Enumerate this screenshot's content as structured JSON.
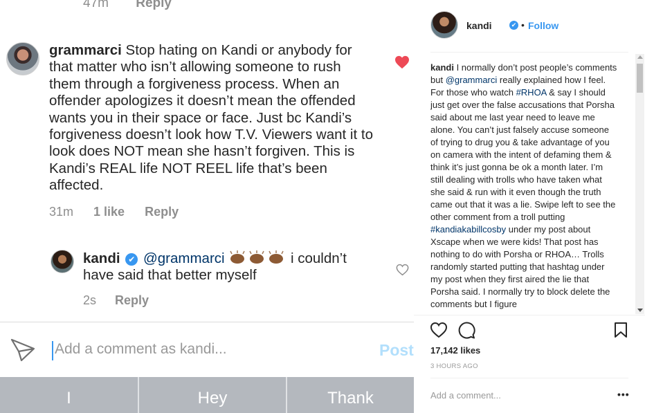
{
  "photo": {
    "top_meta": {
      "time": "47m",
      "reply": "Reply"
    },
    "comment": {
      "user": "grammarci",
      "text": "Stop hating on Kandi or anybody for that matter who isn’t allowing someone to rush them through a forgiveness process. When an offender apologizes it doesn’t mean the offended wants you in their space or face. Just bc Kandi’s forgiveness doesn’t look how T.V. Viewers want it to look does NOT mean she hasn’t forgiven. This is Kandi’s REAL life NOT REEL life that’s been affected.",
      "time": "31m",
      "likes": "1 like",
      "reply": "Reply",
      "liked": true
    },
    "reply_comment": {
      "user": "kandi",
      "verified_glyph": "✔",
      "mention": "@grammarci",
      "text": "i couldn’t have said that better myself",
      "time": "2s",
      "reply": "Reply"
    },
    "compose": {
      "placeholder": "Add a comment as kandi...",
      "post_label": "Post"
    },
    "keyboard_suggestions": [
      "I",
      "Hey",
      "Thank"
    ]
  },
  "panel": {
    "username": "kandi",
    "verified_glyph": "✔",
    "separator": "•",
    "follow_label": "Follow",
    "caption": {
      "user": "kandi",
      "parts": [
        " I normally don’t post people’s comments but ",
        "@grammarci",
        " really explained how I feel. For those who watch ",
        "#RHOA",
        " & say I should just get over the false accusations that Porsha said about me last year need to leave me alone. You can’t just falsely accuse someone of trying to drug you & take advantage of you on camera with the intent of defaming them & think it’s just gonna be ok a month later. I’m still dealing with trolls who have taken what she said & run with it even though the truth came out that it was a lie. Swipe left to see the other comment from a troll putting ",
        "#kandiakabillcosby",
        " under my post about Xscape when we were kids! That post has nothing to do with Porsha or RHOA… Trolls randomly started putting that hashtag under my post when they first aired the lie that Porsha said. I normally try to block delete the comments but I figure"
      ]
    },
    "likes": "17,142 likes",
    "time": "3 HOURS AGO",
    "add_comment_placeholder": "Add a comment...",
    "more_glyph": "•••",
    "colors": {
      "accent": "#3897f0",
      "link": "#003569",
      "like_red": "#ed4956"
    }
  }
}
